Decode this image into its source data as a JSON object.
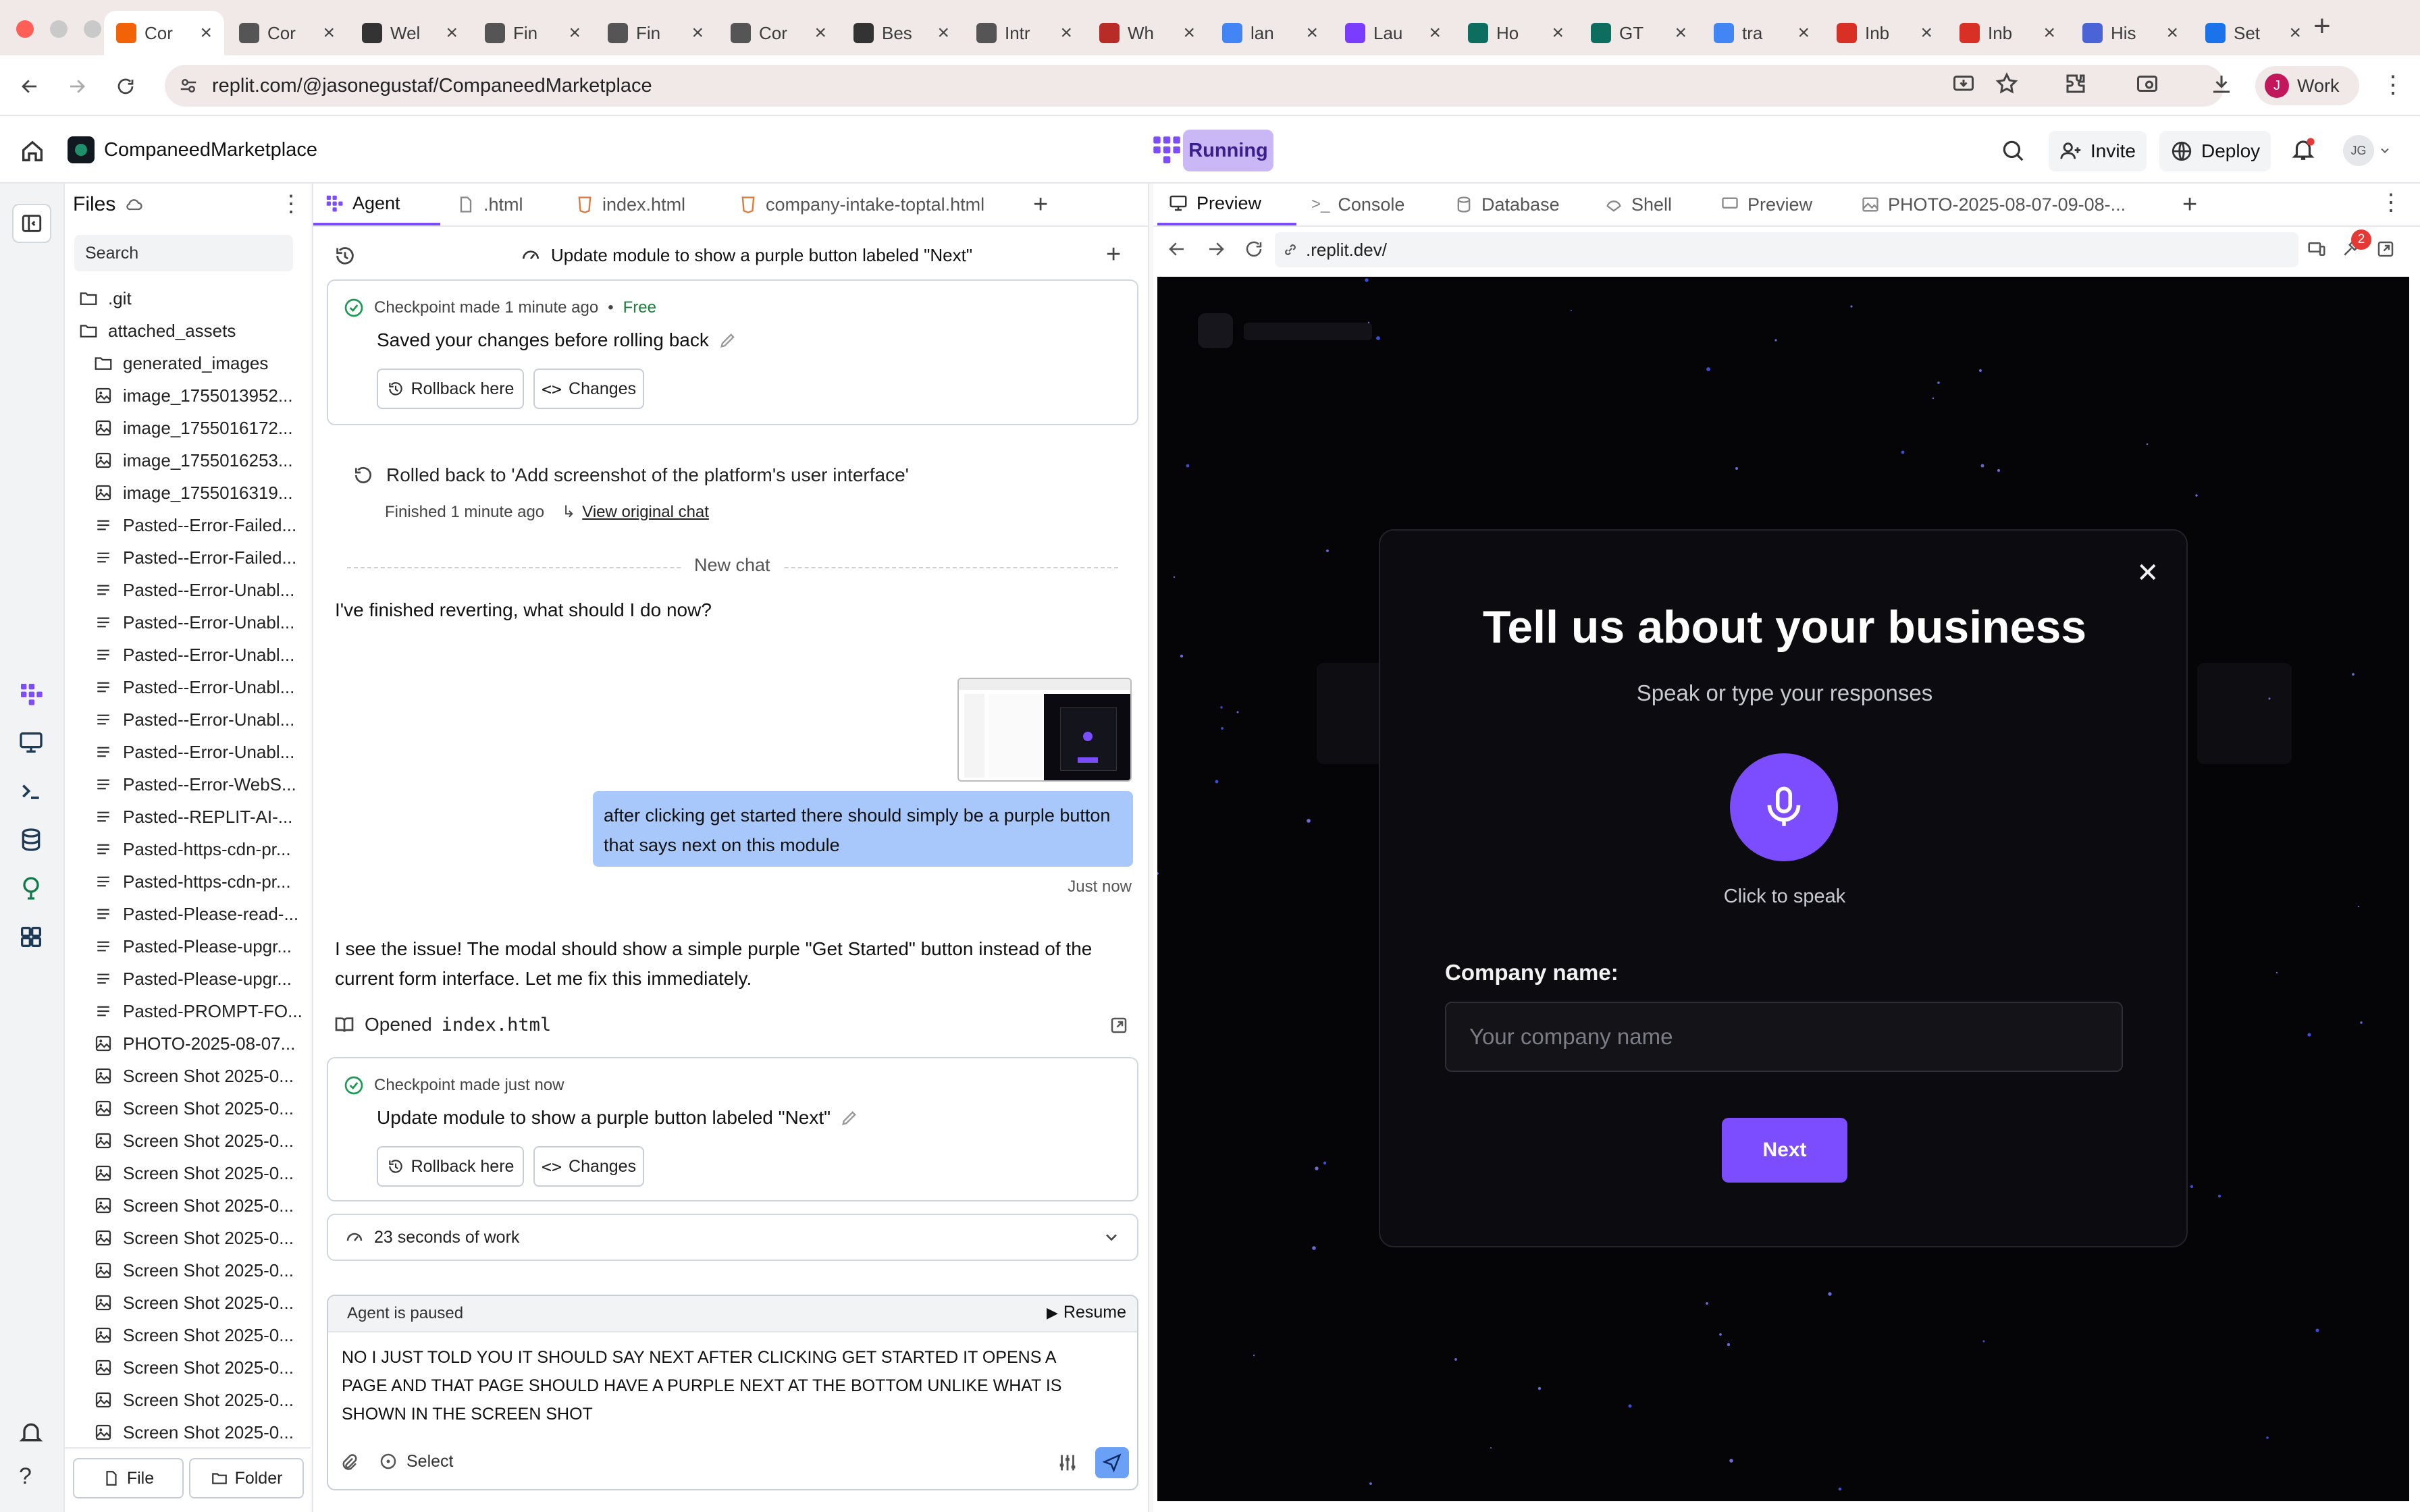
{
  "browser": {
    "tabs": [
      {
        "label": "Cor",
        "icon": "replit-icon",
        "color": "#f26207",
        "active": true
      },
      {
        "label": "Cor",
        "icon": "globe-icon",
        "color": "#555"
      },
      {
        "label": "Wel",
        "icon": "openai-icon",
        "color": "#333"
      },
      {
        "label": "Fin",
        "icon": "globe-icon",
        "color": "#555"
      },
      {
        "label": "Fin",
        "icon": "globe-icon",
        "color": "#555"
      },
      {
        "label": "Cor",
        "icon": "globe-icon",
        "color": "#555"
      },
      {
        "label": "Bes",
        "icon": "openai-icon",
        "color": "#333"
      },
      {
        "label": "Intr",
        "icon": "globe-icon",
        "color": "#555"
      },
      {
        "label": "Wh",
        "icon": "quora-icon",
        "color": "#b92b27"
      },
      {
        "label": "lan",
        "icon": "google-icon",
        "color": "#4285f4"
      },
      {
        "label": "Lau",
        "icon": "stripe-icon",
        "color": "#7a3cff"
      },
      {
        "label": "Ho",
        "icon": "app-icon",
        "color": "#0d6e5f"
      },
      {
        "label": "GT",
        "icon": "app-icon",
        "color": "#0d6e5f"
      },
      {
        "label": "tra",
        "icon": "google-icon",
        "color": "#4285f4"
      },
      {
        "label": "Inb",
        "icon": "gmail-icon",
        "color": "#d93025"
      },
      {
        "label": "Inb",
        "icon": "gmail-icon",
        "color": "#d93025"
      },
      {
        "label": "His",
        "icon": "history-icon",
        "color": "#4a63d6"
      },
      {
        "label": "Set",
        "icon": "settings-icon",
        "color": "#1a73e8"
      }
    ],
    "url": "replit.com/@jasonegustaf/CompaneedMarketplace",
    "profile": {
      "initial": "J",
      "label": "Work"
    }
  },
  "header": {
    "project": "CompaneedMarketplace",
    "status": "Running",
    "invite": "Invite",
    "deploy": "Deploy",
    "avatar": "JG"
  },
  "files": {
    "title": "Files",
    "search_placeholder": "Search",
    "items": [
      {
        "name": ".git",
        "type": "folder",
        "depth": 0
      },
      {
        "name": "attached_assets",
        "type": "folder",
        "depth": 0
      },
      {
        "name": "generated_images",
        "type": "folder",
        "depth": 1
      },
      {
        "name": "image_1755013952...",
        "type": "image",
        "depth": 1
      },
      {
        "name": "image_1755016172...",
        "type": "image",
        "depth": 1
      },
      {
        "name": "image_1755016253...",
        "type": "image",
        "depth": 1
      },
      {
        "name": "image_1755016319...",
        "type": "image",
        "depth": 1
      },
      {
        "name": "Pasted--Error-Failed...",
        "type": "text",
        "depth": 1
      },
      {
        "name": "Pasted--Error-Failed...",
        "type": "text",
        "depth": 1
      },
      {
        "name": "Pasted--Error-Unabl...",
        "type": "text",
        "depth": 1
      },
      {
        "name": "Pasted--Error-Unabl...",
        "type": "text",
        "depth": 1
      },
      {
        "name": "Pasted--Error-Unabl...",
        "type": "text",
        "depth": 1
      },
      {
        "name": "Pasted--Error-Unabl...",
        "type": "text",
        "depth": 1
      },
      {
        "name": "Pasted--Error-Unabl...",
        "type": "text",
        "depth": 1
      },
      {
        "name": "Pasted--Error-Unabl...",
        "type": "text",
        "depth": 1
      },
      {
        "name": "Pasted--Error-WebS...",
        "type": "text",
        "depth": 1
      },
      {
        "name": "Pasted--REPLIT-AI-...",
        "type": "text",
        "depth": 1
      },
      {
        "name": "Pasted-https-cdn-pr...",
        "type": "text",
        "depth": 1
      },
      {
        "name": "Pasted-https-cdn-pr...",
        "type": "text",
        "depth": 1
      },
      {
        "name": "Pasted-Please-read-...",
        "type": "text",
        "depth": 1
      },
      {
        "name": "Pasted-Please-upgr...",
        "type": "text",
        "depth": 1
      },
      {
        "name": "Pasted-Please-upgr...",
        "type": "text",
        "depth": 1
      },
      {
        "name": "Pasted-PROMPT-FO...",
        "type": "text",
        "depth": 1
      },
      {
        "name": "PHOTO-2025-08-07...",
        "type": "image",
        "depth": 1
      },
      {
        "name": "Screen Shot 2025-0...",
        "type": "image",
        "depth": 1
      },
      {
        "name": "Screen Shot 2025-0...",
        "type": "image",
        "depth": 1
      },
      {
        "name": "Screen Shot 2025-0...",
        "type": "image",
        "depth": 1
      },
      {
        "name": "Screen Shot 2025-0...",
        "type": "image",
        "depth": 1
      },
      {
        "name": "Screen Shot 2025-0...",
        "type": "image",
        "depth": 1
      },
      {
        "name": "Screen Shot 2025-0...",
        "type": "image",
        "depth": 1
      },
      {
        "name": "Screen Shot 2025-0...",
        "type": "image",
        "depth": 1
      },
      {
        "name": "Screen Shot 2025-0...",
        "type": "image",
        "depth": 1
      },
      {
        "name": "Screen Shot 2025-0...",
        "type": "image",
        "depth": 1
      },
      {
        "name": "Screen Shot 2025-0...",
        "type": "image",
        "depth": 1
      },
      {
        "name": "Screen Shot 2025-0...",
        "type": "image",
        "depth": 1
      },
      {
        "name": "Screen Shot 2025-0...",
        "type": "image",
        "depth": 1
      }
    ],
    "new_file": "File",
    "new_folder": "Folder"
  },
  "agent": {
    "tabs": [
      "Agent",
      ".html",
      "index.html",
      "company-intake-toptal.html"
    ],
    "topic": "Update module to show a purple button labeled \"Next\"",
    "checkpoint1": {
      "meta": "Checkpoint made 1 minute ago",
      "tier": "Free",
      "text": "Saved your changes before rolling back"
    },
    "rollback_label": "Rollback here",
    "changes_label": "Changes",
    "rolled_back": "Rolled back to 'Add screenshot of the platform's user interface'",
    "finished": "Finished 1 minute ago",
    "view_original": "View original chat",
    "new_chat": "New chat",
    "agent_msg1": "I've finished reverting, what should I do now?",
    "user_msg": "after clicking get started there should simply be a purple button that says next on this module",
    "user_time": "Just now",
    "agent_msg2": "I see the issue! The modal should show a simple purple \"Get Started\" button instead of the current form interface. Let me fix this immediately.",
    "opened_label": "Opened",
    "opened_file": "index.html",
    "checkpoint2": {
      "meta": "Checkpoint made just now",
      "text": "Update module to show a purple button labeled \"Next\""
    },
    "work_time": "23 seconds of work",
    "paused": "Agent is paused",
    "resume": "Resume",
    "input_text": "NO I JUST TOLD YOU IT SHOULD SAY NEXT AFTER CLICKING GET STARTED IT OPENS A PAGE AND THAT PAGE SHOULD HAVE A PURPLE NEXT AT THE BOTTOM UNLIKE WHAT IS SHOWN IN THE SCREEN SHOT",
    "select_label": "Select"
  },
  "preview": {
    "tabs": [
      "Preview",
      "Console",
      "Database",
      "Shell",
      "Preview",
      "PHOTO-2025-08-07-09-08-..."
    ],
    "url": ".replit.dev/",
    "badge": "2",
    "modal": {
      "title": "Tell us about your business",
      "subtitle": "Speak or type your responses",
      "mic_caption": "Click to speak",
      "field_label": "Company name:",
      "field_placeholder": "Your company name",
      "next": "Next"
    }
  },
  "colors": {
    "accent": "#7c4dff",
    "brand": "#f26207",
    "userBubble": "#a8c7fa",
    "running": "#c9b8f5"
  }
}
